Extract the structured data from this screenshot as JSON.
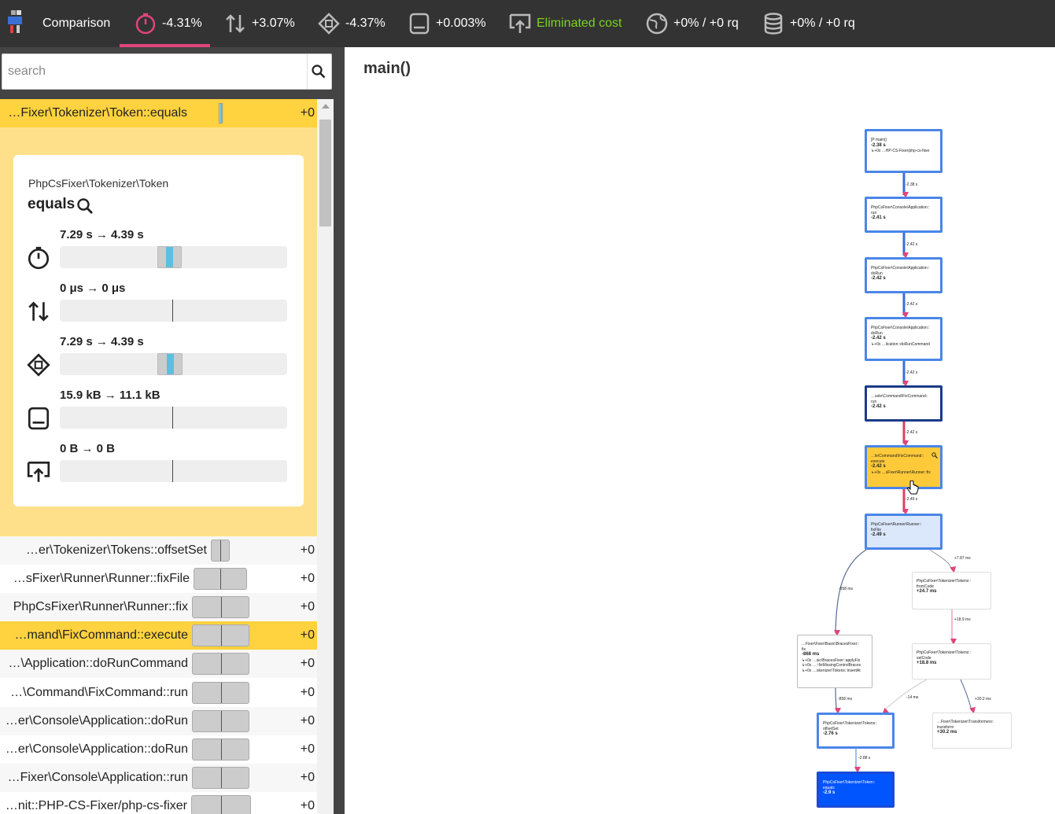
{
  "topbar": {
    "app": "Comparison",
    "metrics": [
      {
        "icon": "stopwatch-icon",
        "value": "-4.31%",
        "active": true
      },
      {
        "icon": "arrows-updown-icon",
        "value": "+3.07%"
      },
      {
        "icon": "cpu-icon",
        "value": "-4.37%"
      },
      {
        "icon": "memory-icon",
        "value": "+0.003%"
      },
      {
        "icon": "network-icon",
        "value": "Eliminated cost"
      },
      {
        "icon": "globe-icon",
        "value": "+0% / +0 rq"
      },
      {
        "icon": "database-icon",
        "value": "+0% / +0 rq"
      }
    ]
  },
  "search": {
    "placeholder": "search"
  },
  "list": {
    "selected": {
      "name": "…Fixer\\Tokenizer\\Token::equals",
      "value": "+0"
    },
    "detail": {
      "namespace": "PhpCsFixer\\Tokenizer\\Token",
      "function": "equals",
      "metrics": [
        {
          "icon": "stopwatch-icon",
          "text": "7.29 s → 4.39 s"
        },
        {
          "icon": "arrows-updown-icon",
          "text": "0 μs → 0 μs"
        },
        {
          "icon": "cpu-icon",
          "text": "7.29 s → 4.39 s"
        },
        {
          "icon": "memory-icon",
          "text": "15.9 kB → 11.1 kB"
        },
        {
          "icon": "network-icon",
          "text": "0 B → 0 B"
        }
      ]
    },
    "rows": [
      {
        "name": "…er\\Tokenizer\\Tokens::offsetSet",
        "value": "+0"
      },
      {
        "name": "…sFixer\\Runner\\Runner::fixFile",
        "value": "+0"
      },
      {
        "name": "PhpCsFixer\\Runner\\Runner::fix",
        "value": "+0"
      },
      {
        "name": "…mand\\FixCommand::execute",
        "value": "+0",
        "selected": true
      },
      {
        "name": "…\\Application::doRunCommand",
        "value": "+0"
      },
      {
        "name": "…\\Command\\FixCommand::run",
        "value": "+0"
      },
      {
        "name": "…er\\Console\\Application::doRun",
        "value": "+0"
      },
      {
        "name": "…er\\Console\\Application::doRun",
        "value": "+0"
      },
      {
        "name": "…Fixer\\Console\\Application::run",
        "value": "+0"
      },
      {
        "name": "…nit::PHP-CS-Fixer/php-cs-fixer",
        "value": "+0"
      }
    ]
  },
  "main": {
    "title": "main()"
  },
  "graph": {
    "nodes": [
      {
        "id": "n1",
        "l1": "[P main()",
        "v": "-2.38 s",
        "l3": "↳+0x  …HP-CS-Fixer/php-cs-fixer"
      },
      {
        "id": "n2",
        "l1": "PhpCsFixer\\Console\\Application::",
        "l2": "run",
        "v": "-2.41 s"
      },
      {
        "id": "n3",
        "l1": "PhpCsFixer\\Console\\Application::",
        "l2": "doRun",
        "v": "-2.42 s"
      },
      {
        "id": "n4",
        "l1": "PhpCsFixer\\Console\\Application::",
        "l2": "doRun",
        "v": "-2.42 s",
        "l3": "↳+0x  …lication::doRunCommand"
      },
      {
        "id": "n5",
        "l1": "…sole\\Command\\FixCommand::",
        "l2": "run",
        "v": "-2.42 s"
      },
      {
        "id": "n6",
        "l1": "…le\\Command\\FixCommand::",
        "l2": "execute",
        "v": "-2.42 s",
        "l3": "↳+0x  …sFixer\\Runner\\Runner::fix"
      },
      {
        "id": "n7",
        "l1": "PhpCsFixer\\Runner\\Runner::",
        "l2": "fixFile",
        "v": "-2.49 s"
      },
      {
        "id": "n8",
        "l1": "PhpCsFixer\\Tokenizer\\Tokens::",
        "l2": "fromCode",
        "v": "+24.7 ms"
      },
      {
        "id": "n9",
        "l1": "…Fixer\\Fixer\\Basic\\BracesFixer::",
        "l2": "fix",
        "v": "-868 ms",
        "l3": "↳+0x  …sic\\BracesFixer::applyFix",
        "l4": "↳+0x  …::fixMissingControlBraces",
        "l5": "↳+0x  …okenizer\\Tokens::insertAt"
      },
      {
        "id": "n10",
        "l1": "PhpCsFixer\\Tokenizer\\Tokens::",
        "l2": "setCode",
        "v": "+18.8 ms"
      },
      {
        "id": "n11",
        "l1": "PhpCsFixer\\Tokenizer\\Tokens::",
        "l2": "offsetSet",
        "v": "-2.76 s"
      },
      {
        "id": "n12",
        "l1": "…Fixer\\Tokenizer\\Transformers::",
        "l2": "transform",
        "v": "+30.2 ms"
      },
      {
        "id": "n13",
        "l1": "PhpCsFixer\\Tokenizer\\Token::",
        "l2": "equals",
        "v": "-2.9 s"
      }
    ],
    "edges": [
      "-2.38 s",
      "-2.42 s",
      "-2.42 s",
      "-2.42 s",
      "-2.42 s",
      "-2.49 s",
      "+7.87 ms",
      "-858 ms",
      "+18.9 ms",
      "-858 ms",
      "-14 ms",
      "+30.2 ms",
      "-2.88 s"
    ]
  }
}
